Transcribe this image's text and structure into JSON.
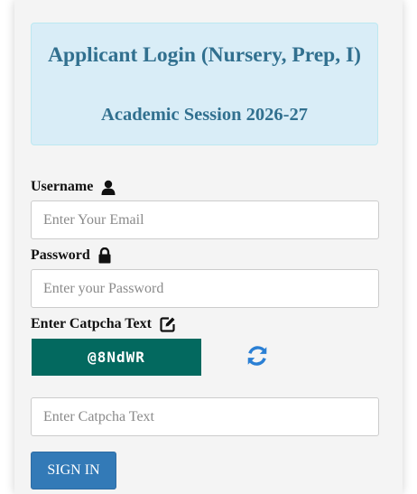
{
  "header": {
    "title": "Applicant Login (Nursery, Prep, I)",
    "subtitle": "Academic Session 2026-27"
  },
  "form": {
    "username_label": "Username",
    "username_placeholder": "Enter Your Email",
    "username_icon": "user-icon",
    "password_label": "Password",
    "password_placeholder": "Enter your Password",
    "password_icon": "lock-icon",
    "captcha_label": "Enter Catpcha Text",
    "captcha_icon": "edit-icon",
    "captcha_code": "@8NdWR",
    "refresh_icon": "refresh-icon",
    "captcha_placeholder": "Enter Catpcha Text",
    "signin_label": "SIGN IN"
  },
  "colors": {
    "header_bg": "#d9edf7",
    "header_text": "#31708f",
    "captcha_bg": "#03695f",
    "refresh": "#2a7fd4",
    "button": "#337ab7"
  }
}
